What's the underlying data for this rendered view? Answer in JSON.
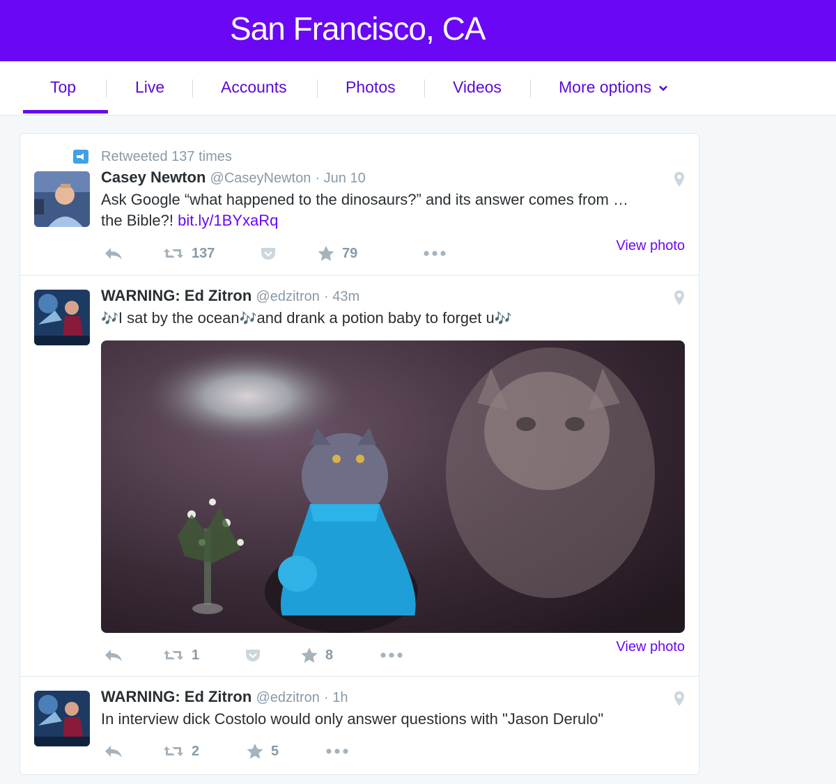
{
  "header": {
    "title": "San Francisco, CA"
  },
  "tabs": [
    {
      "label": "Top"
    },
    {
      "label": "Live"
    },
    {
      "label": "Accounts"
    },
    {
      "label": "Photos"
    },
    {
      "label": "Videos"
    },
    {
      "label": "More options"
    }
  ],
  "tweets": [
    {
      "retweet_label": "Retweeted 137 times",
      "name": "Casey Newton",
      "handle": "@CaseyNewton",
      "time": "· Jun 10",
      "text_line1": "Ask Google “what happened to the dinosaurs?” and its answer comes from …",
      "text_line2_prefix": "the Bible?! ",
      "link": "bit.ly/1BYxaRq",
      "retweets": "137",
      "likes": "79",
      "view_photo": "View photo"
    },
    {
      "name": "WARNING: Ed Zitron",
      "handle": "@edzitron",
      "time": "· 43m",
      "text_a": "I sat by the ocean",
      "text_b": "and drank a potion baby to forget u",
      "note": "🎶",
      "retweets": "1",
      "likes": "8",
      "view_photo": "View photo"
    },
    {
      "name": "WARNING: Ed Zitron",
      "handle": "@edzitron",
      "time": "· 1h",
      "text": "In interview dick Costolo would only answer questions with \"Jason Derulo\"",
      "retweets": "2",
      "likes": "5"
    }
  ],
  "colors": {
    "brand": "#6a07f5",
    "muted": "#8899a6",
    "text": "#292f33"
  },
  "icons": [
    "reply-icon",
    "retweet-icon",
    "pocket-icon",
    "star-icon",
    "more-icon",
    "location-pin-icon",
    "retweet-badge-icon",
    "chevron-down-icon"
  ]
}
